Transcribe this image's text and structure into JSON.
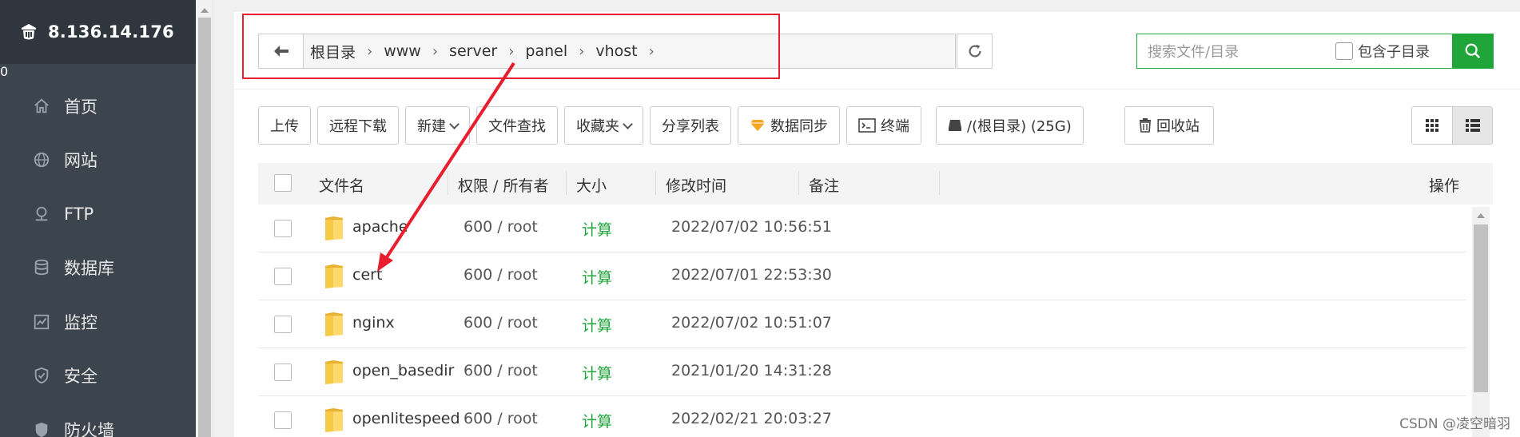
{
  "sidebar": {
    "ip": "8.136.14.176",
    "badge": "0",
    "items": [
      {
        "label": "首页",
        "icon": "home-icon"
      },
      {
        "label": "网站",
        "icon": "globe-icon"
      },
      {
        "label": "FTP",
        "icon": "ftp-icon"
      },
      {
        "label": "数据库",
        "icon": "database-icon"
      },
      {
        "label": "监控",
        "icon": "monitor-icon"
      },
      {
        "label": "安全",
        "icon": "shield-icon"
      },
      {
        "label": "防火墙",
        "icon": "firewall-icon"
      }
    ]
  },
  "breadcrumb": [
    "根目录",
    "www",
    "server",
    "panel",
    "vhost"
  ],
  "search": {
    "placeholder": "搜索文件/目录",
    "include_sub_label": "包含子目录"
  },
  "toolbar": {
    "upload": "上传",
    "remote_download": "远程下载",
    "new": "新建",
    "find": "文件查找",
    "favorites": "收藏夹",
    "share_list": "分享列表",
    "sync": "数据同步",
    "terminal": "终端",
    "disk": "/(根目录) (25G)",
    "recycle": "回收站"
  },
  "table": {
    "headers": {
      "name": "文件名",
      "perm": "权限 / 所有者",
      "size": "大小",
      "mtime": "修改时间",
      "note": "备注",
      "ops": "操作"
    },
    "rows": [
      {
        "name": "apache",
        "perm": "600 / root",
        "size": "计算",
        "mtime": "2022/07/02 10:56:51"
      },
      {
        "name": "cert",
        "perm": "600 / root",
        "size": "计算",
        "mtime": "2022/07/01 22:53:30"
      },
      {
        "name": "nginx",
        "perm": "600 / root",
        "size": "计算",
        "mtime": "2022/07/02 10:51:07"
      },
      {
        "name": "open_basedir",
        "perm": "600 / root",
        "size": "计算",
        "mtime": "2021/01/20 14:31:28"
      },
      {
        "name": "openlitespeed",
        "perm": "600 / root",
        "size": "计算",
        "mtime": "2022/02/21 20:03:27"
      }
    ]
  },
  "watermark": "CSDN @凌空暗羽",
  "colors": {
    "accent": "#20a53a",
    "annotation": "#e81e2e",
    "sidebar": "#3c444d",
    "badge": "#f0741c"
  }
}
